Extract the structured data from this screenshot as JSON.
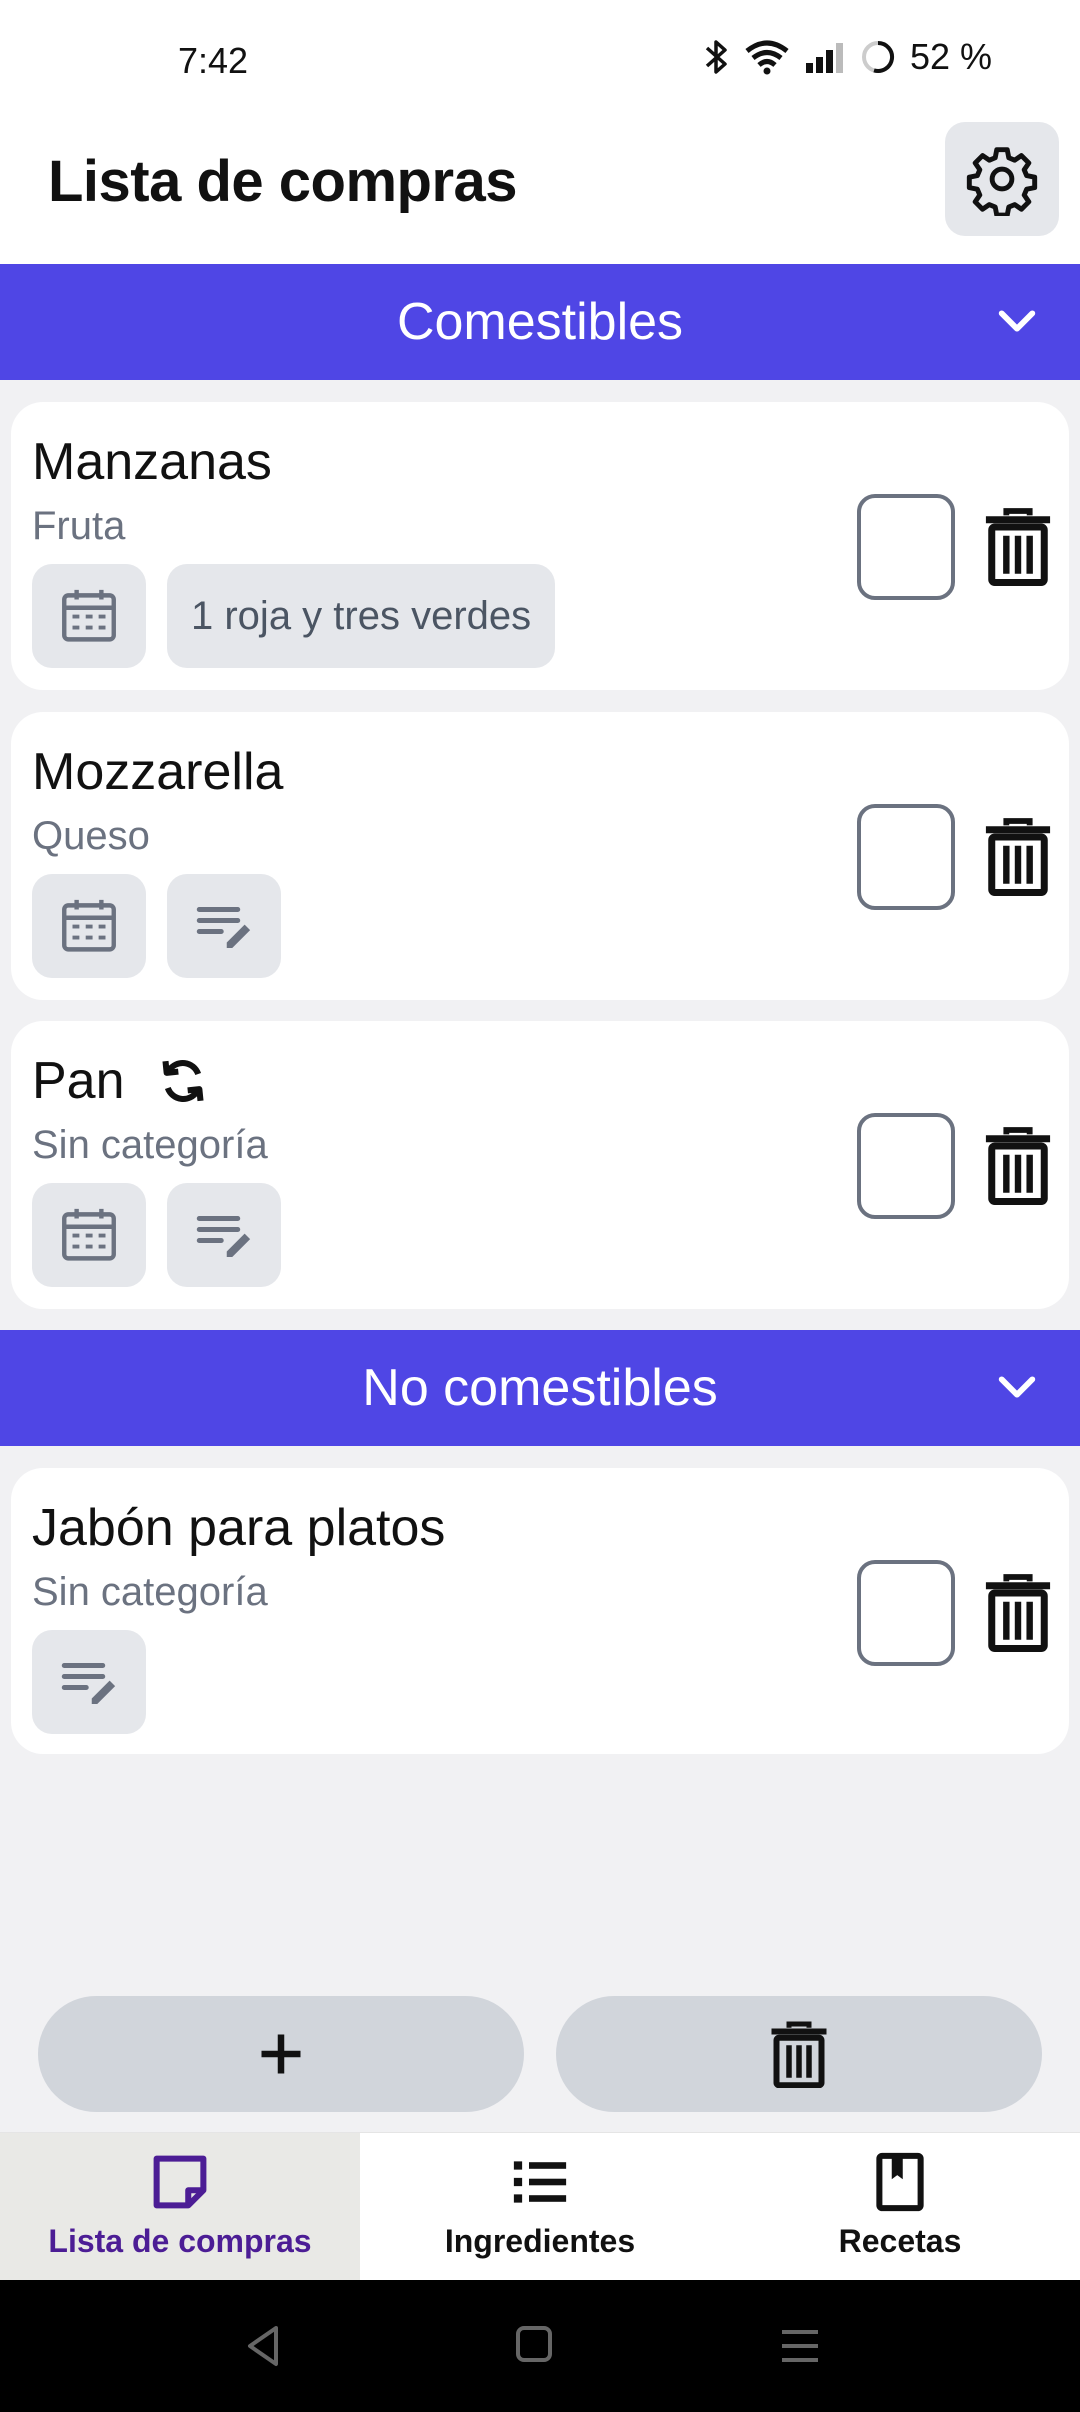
{
  "status": {
    "time": "7:42",
    "battery": "52 %"
  },
  "app": {
    "title": "Lista de compras"
  },
  "colors": {
    "accent": "#4f46e5",
    "nav_active": "#4c1d95"
  },
  "sections": [
    {
      "title": "Comestibles",
      "items": [
        {
          "name": "Manzanas",
          "category": "Fruta",
          "note": "1 roja y tres verdes",
          "recurring": false,
          "checked": false
        },
        {
          "name": "Mozzarella",
          "category": "Queso",
          "note": "",
          "recurring": false,
          "checked": false
        },
        {
          "name": "Pan",
          "category": "Sin categoría",
          "note": "",
          "recurring": true,
          "checked": false
        }
      ]
    },
    {
      "title": "No comestibles",
      "items": [
        {
          "name": "Jabón para platos",
          "category": "Sin categoría",
          "note": "",
          "recurring": false,
          "checked": false
        }
      ]
    }
  ],
  "bottom_nav": {
    "items": [
      {
        "label": "Lista de compras",
        "icon": "shopping-list-icon",
        "active": true
      },
      {
        "label": "Ingredientes",
        "icon": "list-icon",
        "active": false
      },
      {
        "label": "Recetas",
        "icon": "book-icon",
        "active": false
      }
    ]
  }
}
